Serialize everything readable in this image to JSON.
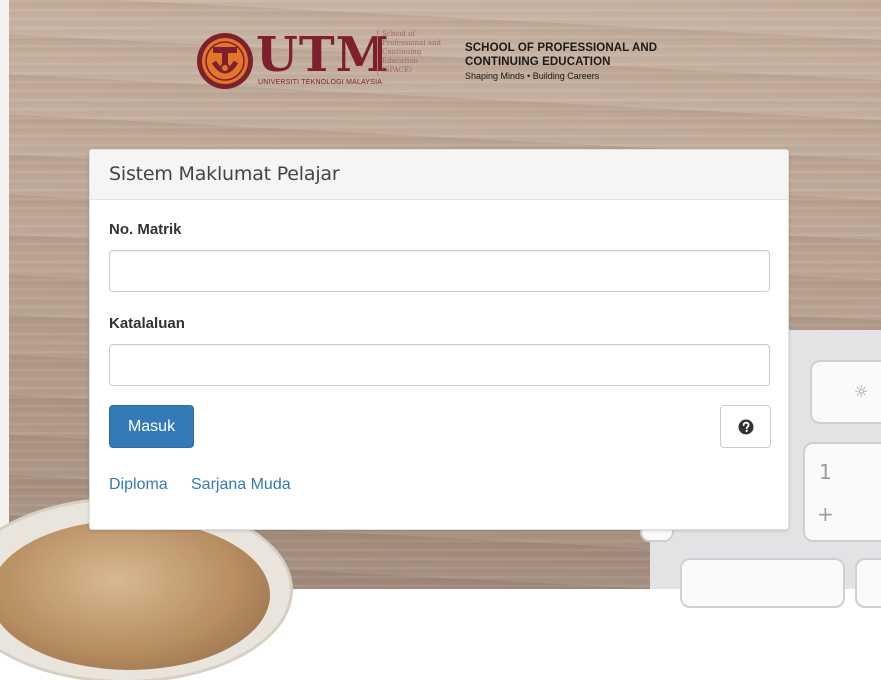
{
  "header": {
    "logo_letters": "UTM",
    "logo_subtext": "UNIVERSITI TEKNOLOGI MALAYSIA",
    "space_lines": [
      "School of",
      "Professional and",
      "Continuing",
      "Education",
      "(SPACE)"
    ],
    "school_title_line1": "SCHOOL OF PROFESSIONAL AND",
    "school_title_line2": "CONTINUING EDUCATION",
    "tagline": "Shaping Minds • Building Careers",
    "brand_color": "#7d1f2c",
    "seal_color": "#e2762a"
  },
  "panel": {
    "title": "Sistem Maklumat Pelajar",
    "matric_label": "No. Matrik",
    "matric_value": "",
    "password_label": "Katalaluan",
    "password_value": "",
    "login_label": "Masuk",
    "help_icon": "question-circle-icon",
    "links": [
      "Diploma",
      "Sarjana Muda"
    ],
    "accent_color": "#337ab7"
  },
  "keyboard": {
    "keys": [
      "☼",
      "1",
      "+"
    ]
  }
}
